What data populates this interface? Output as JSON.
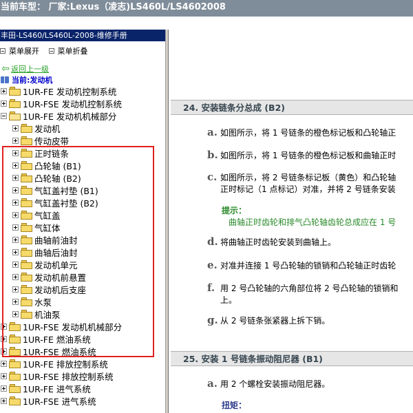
{
  "title_bar": {
    "text": "当前车型：  厂家:Lexus（凌志)LS460L/LS4602008"
  },
  "manual_header": {
    "text": "丰田-LS460/LS460L-2008-维修手册"
  },
  "toolbar": {
    "expand_label": "菜单展开",
    "collapse_label": "菜单折叠"
  },
  "nav": {
    "back_label": "返回上一级",
    "current_label": "当前:发动机"
  },
  "tree": {
    "nodes": [
      {
        "label": "1UR-FE 发动机控制系统"
      },
      {
        "label": "1UR-FSE 发动机控制系统"
      },
      {
        "label": "1UR-FE 发动机机械部分"
      },
      {
        "label": "发动机"
      },
      {
        "label": "传动皮带"
      },
      {
        "label": "正时链条"
      },
      {
        "label": "凸轮轴 (B1)"
      },
      {
        "label": "凸轮轴 (B2)"
      },
      {
        "label": "气缸盖衬垫 (B1)"
      },
      {
        "label": "气缸盖衬垫 (B2)"
      },
      {
        "label": "气缸盖"
      },
      {
        "label": "气缸体"
      },
      {
        "label": "曲轴前油封"
      },
      {
        "label": "曲轴后油封"
      },
      {
        "label": "发动机单元"
      },
      {
        "label": "发动机前悬置"
      },
      {
        "label": "发动机后支座"
      },
      {
        "label": "水泵"
      },
      {
        "label": "机油泵"
      },
      {
        "label": "1UR-FSE 发动机机械部分"
      },
      {
        "label": "1UR-FE 燃油系统"
      },
      {
        "label": "1UR-FSE 燃油系统"
      },
      {
        "label": "1UR-FE 排放控制系统"
      },
      {
        "label": "1UR-FSE 排放控制系统"
      },
      {
        "label": "1UR-FE 进气系统"
      },
      {
        "label": "1UR-FSE 进气系统"
      }
    ]
  },
  "content": {
    "section1": {
      "title": "24. 安装链条分总成 (B2)",
      "steps": [
        {
          "letter": "a.",
          "line1": "如图所示，将 1 号链条的橙色标记板和凸轮轴正"
        },
        {
          "letter": "b.",
          "line1": "如图所示，将 1 号链条的橙色标记板和曲轴正时"
        },
        {
          "letter": "c.",
          "line1": "如图所示，将 2 号链条标记板（黄色）和凸轮轴",
          "line2": "正时标记（1 点标记）对准，并将 2 号链条安装"
        },
        {
          "letter": "d.",
          "line1": "将曲轴正时齿轮安装到曲轴上。"
        },
        {
          "letter": "e.",
          "line1": "对准并连接 1 号凸轮轴的锁销和凸轮轴正时齿轮"
        },
        {
          "letter": "f.",
          "line1": "用 2 号凸轮轴的六角部位将 2 号凸轮轴的锁销和",
          "line2": "上。"
        },
        {
          "letter": "g.",
          "line1": "从 2 号链条张紧器上拆下销。"
        }
      ],
      "hint_label": "提示：",
      "hint_text": "曲轴正时齿轮和排气凸轮轴齿轮总成应在 1 号"
    },
    "section2": {
      "title": "25. 安装 1 号链条振动阻尼器 (B1)",
      "steps": [
        {
          "letter": "a.",
          "line1": "用 2 个螺栓安装振动阻尼器。"
        }
      ],
      "torque_label": "扭矩："
    }
  }
}
